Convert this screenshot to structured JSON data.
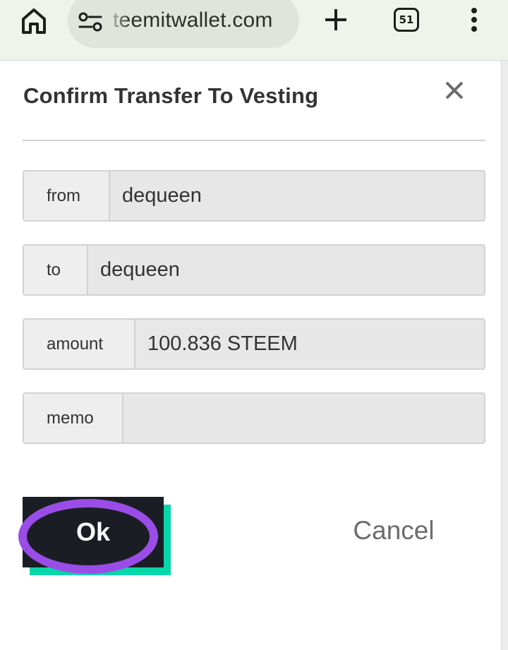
{
  "browser": {
    "url": "teemitwallet.com",
    "tab_count": "51",
    "icons": [
      "home-icon",
      "site-settings-icon",
      "plus-icon",
      "tabs-icon",
      "more-vert-icon"
    ]
  },
  "dialog": {
    "title": "Confirm Transfer To Vesting",
    "close_icon": "close-icon",
    "fields": {
      "from": {
        "label": "from",
        "value": "dequeen"
      },
      "to": {
        "label": "to",
        "value": "dequeen"
      },
      "amount": {
        "label": "amount",
        "value": "100.836 STEEM"
      },
      "memo": {
        "label": "memo",
        "value": ""
      }
    },
    "ok_label": "Ok",
    "cancel_label": "Cancel"
  },
  "colors": {
    "toolbar_bg": "#eef4e9",
    "url_pill_bg": "#dfe5da",
    "ok_bg": "#1a1e24",
    "ok_shadow": "#06d6a9",
    "highlight_ring": "#9a4de6",
    "cancel_text": "#6d6d6d"
  }
}
